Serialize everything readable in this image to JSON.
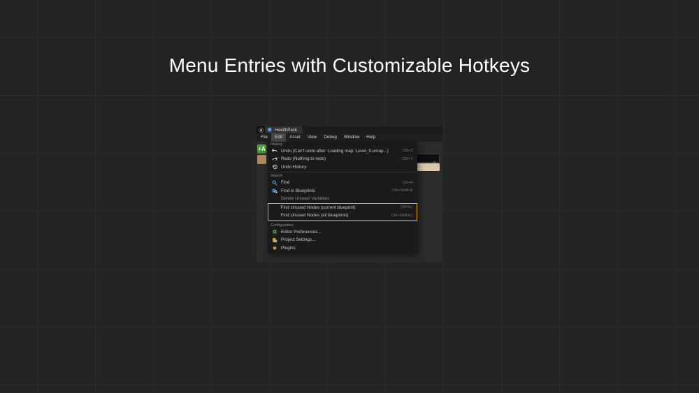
{
  "page": {
    "title": "Menu Entries with Customizable Hotkeys"
  },
  "window": {
    "tab_title": "HealthPack",
    "menubar": [
      "File",
      "Edit",
      "Asset",
      "View",
      "Debug",
      "Window",
      "Help"
    ],
    "open_menu_index": 1
  },
  "toolbar": {
    "add_button_label": "+A"
  },
  "edit_menu": {
    "sections": [
      {
        "title": "History",
        "items": [
          {
            "icon": "undo-icon",
            "label": "Undo (Can't undo after: Loading map: Level_0.umap...)",
            "hotkey": "Ctrl+Z",
            "enabled": true
          },
          {
            "icon": "redo-icon",
            "label": "Redo (Nothing to redo)",
            "hotkey": "Ctrl+Y",
            "enabled": true
          },
          {
            "icon": "history-icon",
            "label": "Undo History",
            "hotkey": "",
            "enabled": true
          }
        ]
      },
      {
        "title": "Search",
        "items": [
          {
            "icon": "find-icon",
            "label": "Find",
            "hotkey": "Ctrl+F",
            "enabled": true
          },
          {
            "icon": "find-blueprints-icon",
            "label": "Find in Blueprints",
            "hotkey": "Ctrl+Shift+F",
            "enabled": true
          },
          {
            "icon": "",
            "label": "Delete Unused Variables",
            "hotkey": "",
            "enabled": false
          }
        ],
        "highlighted_items": [
          {
            "label": "Find Unused Nodes (current blueprint)",
            "hotkey": "Ctrl+U"
          },
          {
            "label": "Find Unused Nodes (all blueprints)",
            "hotkey": "Ctrl+Shift+U"
          }
        ]
      },
      {
        "title": "Configuration",
        "items": [
          {
            "icon": "preferences-icon",
            "label": "Editor Preferences...",
            "hotkey": "",
            "enabled": true
          },
          {
            "icon": "project-settings-icon",
            "label": "Project Settings...",
            "hotkey": "",
            "enabled": true
          },
          {
            "icon": "plugins-icon",
            "label": "Plugins",
            "hotkey": "",
            "enabled": true
          }
        ]
      }
    ]
  }
}
